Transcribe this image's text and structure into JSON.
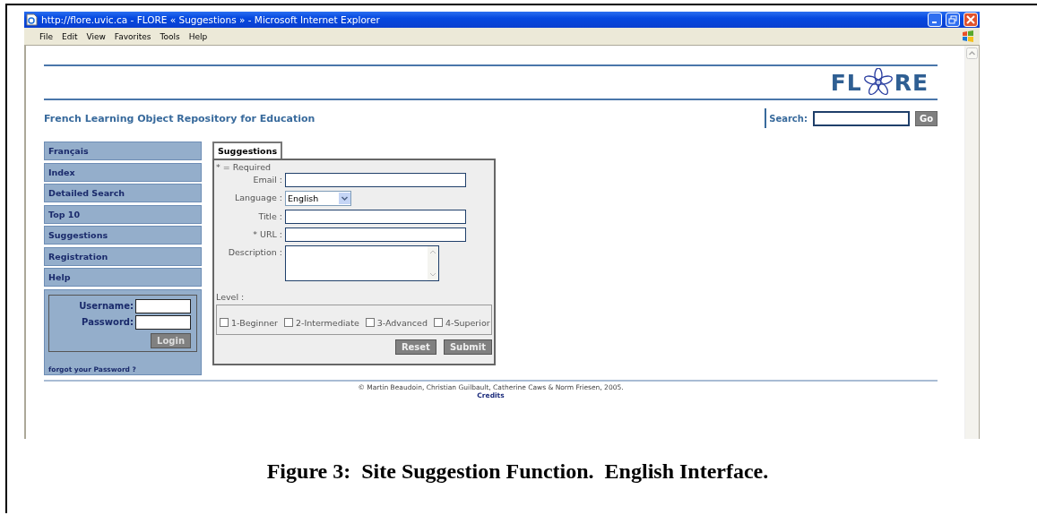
{
  "window": {
    "title": "http://flore.uvic.ca - FLORE « Suggestions » - Microsoft Internet Explorer",
    "menu": [
      "File",
      "Edit",
      "View",
      "Favorites",
      "Tools",
      "Help"
    ]
  },
  "header": {
    "logo_left": "FL",
    "logo_right": "RE",
    "subtitle": "French Learning Object Repository for Education",
    "search_label": "Search:",
    "search_button": "Go"
  },
  "sidebar": {
    "items": [
      "Français",
      "Index",
      "Detailed Search",
      "Top 10",
      "Suggestions",
      "Registration",
      "Help"
    ],
    "login": {
      "username_label": "Username:",
      "password_label": "Password:",
      "button": "Login",
      "forgot_link": "forgot your Password ?"
    }
  },
  "form": {
    "tab": {
      "label": "Suggestions",
      "selected": true
    },
    "required_note": "* = Required",
    "fields": [
      {
        "kind": "text",
        "label": "Email :"
      },
      {
        "kind": "select",
        "label": "Language :",
        "value": "English"
      },
      {
        "kind": "text",
        "label": "Title :"
      },
      {
        "kind": "text",
        "label": "* URL :"
      },
      {
        "kind": "textarea",
        "label": "Description :"
      }
    ],
    "level_label": "Level :",
    "levels": [
      {
        "label": "1-Beginner",
        "checked": false
      },
      {
        "label": "2-Intermediate",
        "checked": false
      },
      {
        "label": "3-Advanced",
        "checked": false
      },
      {
        "label": "4-Superior",
        "checked": false
      }
    ],
    "buttons": [
      "Reset",
      "Submit"
    ]
  },
  "footer": {
    "copyright": "© Martin Beaudoin, Christian Guilbault, Catherine Caws & Norm Friesen, 2005.",
    "credits": "Credits"
  },
  "caption": "Figure 3:  Site Suggestion Function.  English Interface."
}
